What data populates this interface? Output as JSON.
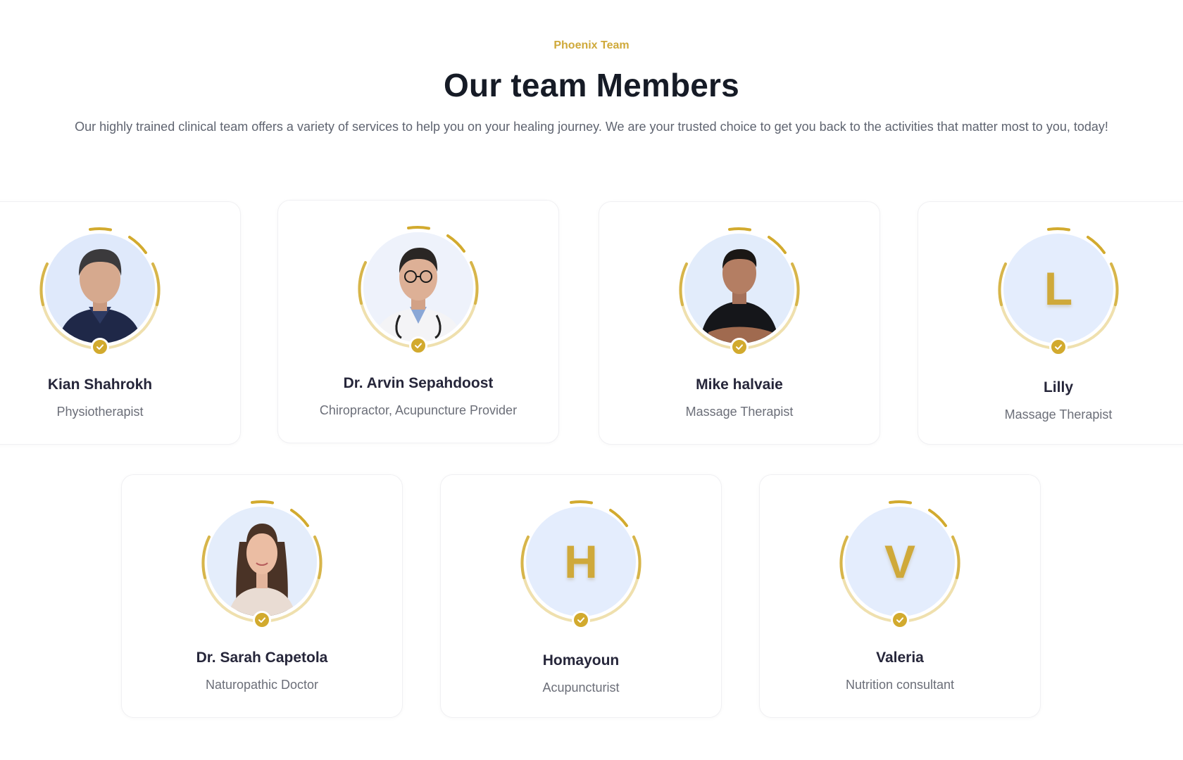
{
  "section": {
    "eyebrow": "Phoenix Team",
    "title": "Our team Members",
    "description": "Our highly trained clinical team offers a variety of services to help you on your healing journey. We are your trusted choice to get you back to the activities that matter most to you, today!"
  },
  "colors": {
    "accent": "#cfa93a",
    "avatar_background": "#e4edfd",
    "heading": "#161b26",
    "body_text": "#5f6470"
  },
  "members": [
    {
      "name": "Kian Shahrokh",
      "role": "Physiotherapist",
      "avatar": "photo",
      "verified": true
    },
    {
      "name": "Dr. Arvin Sepahdoost",
      "role": "Chiropractor, Acupuncture Provider",
      "avatar": "photo",
      "verified": true
    },
    {
      "name": "Mike halvaie",
      "role": "Massage Therapist",
      "avatar": "photo",
      "verified": true
    },
    {
      "name": "Lilly",
      "role": "Massage Therapist",
      "avatar": "initial",
      "initial": "L",
      "verified": true
    },
    {
      "name": "Dr. Sarah Capetola",
      "role": "Naturopathic Doctor",
      "avatar": "photo",
      "verified": true
    },
    {
      "name": "Homayoun",
      "role": "Acupuncturist",
      "avatar": "initial",
      "initial": "H",
      "verified": true
    },
    {
      "name": "Valeria",
      "role": "Nutrition consultant",
      "avatar": "initial",
      "initial": "V",
      "verified": true
    }
  ],
  "icons": {
    "verified": "check-circle-icon",
    "ring": "dashed-ring-decoration"
  }
}
